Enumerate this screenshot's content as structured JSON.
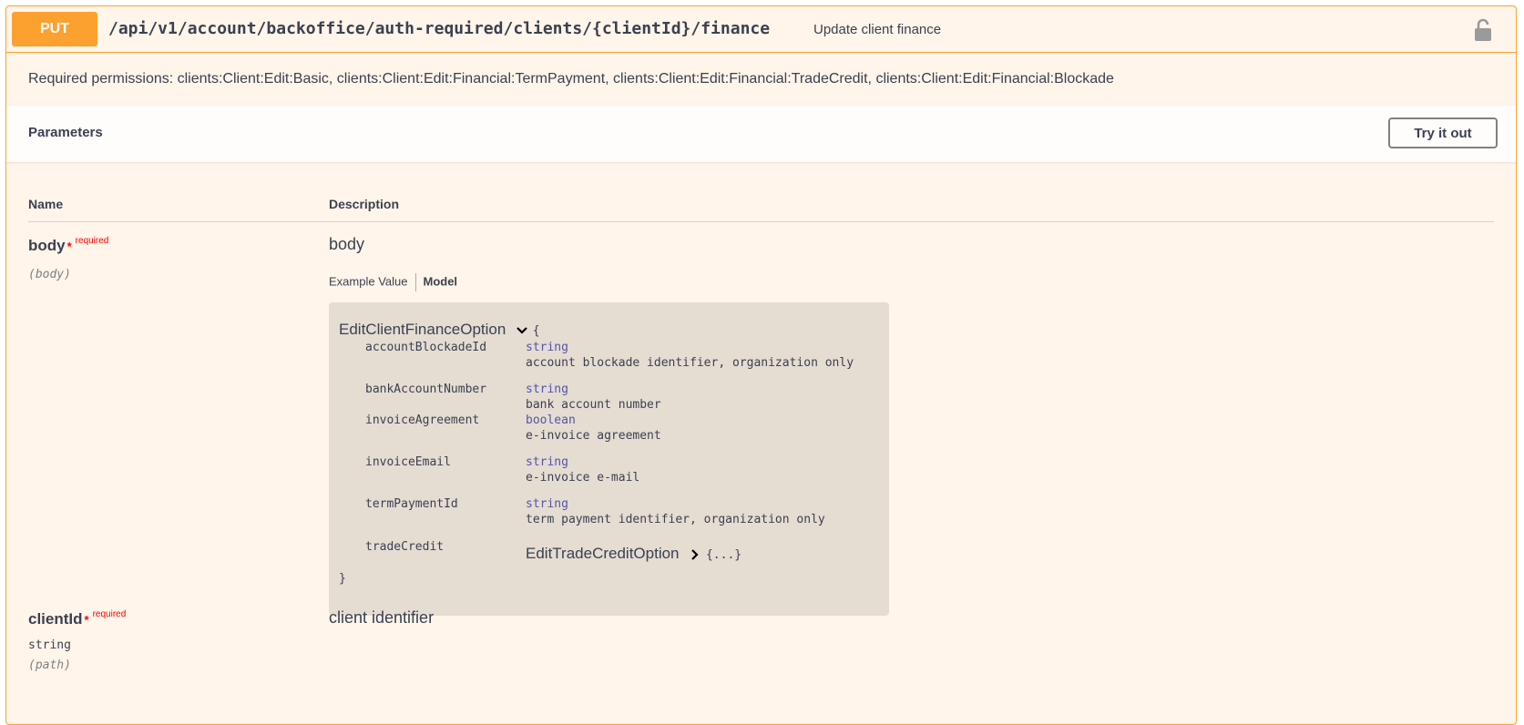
{
  "operation": {
    "method": "PUT",
    "path": "/api/v1/account/backoffice/auth-required/clients/{clientId}/finance",
    "summary": "Update client finance",
    "lock_icon": "lock-open-icon",
    "permissions": "Required permissions: clients:Client:Edit:Basic, clients:Client:Edit:Financial:TermPayment, clients:Client:Edit:Financial:TradeCredit, clients:Client:Edit:Financial:Blockade",
    "accent_color": "#fca130"
  },
  "parameters": {
    "title": "Parameters",
    "try_label": "Try it out",
    "col_name": "Name",
    "col_desc": "Description",
    "items": [
      {
        "name": "body",
        "required_star": "*",
        "required_label": "required",
        "in": "(body)",
        "description": "body",
        "tab_example": "Example Value",
        "tab_model": "Model",
        "model": {
          "title": "EditClientFinanceOption",
          "open_brace": "{",
          "close_brace": "}",
          "props": [
            {
              "name": "accountBlockadeId",
              "type": "string",
              "desc": "account blockade identifier, organization only"
            },
            {
              "name": "bankAccountNumber",
              "type": "string",
              "desc": "bank account number"
            },
            {
              "name": "invoiceAgreement",
              "type": "boolean",
              "desc": "e-invoice agreement"
            },
            {
              "name": "invoiceEmail",
              "type": "string",
              "desc": "e-invoice e-mail"
            },
            {
              "name": "termPaymentId",
              "type": "string",
              "desc": "term payment identifier, organization only"
            },
            {
              "name": "tradeCredit",
              "ref": "EditTradeCreditOption",
              "collapsed": "{...}"
            }
          ]
        }
      },
      {
        "name": "clientId",
        "required_star": "*",
        "required_label": "required",
        "type": "string",
        "in": "(path)",
        "description": "client identifier"
      }
    ]
  }
}
